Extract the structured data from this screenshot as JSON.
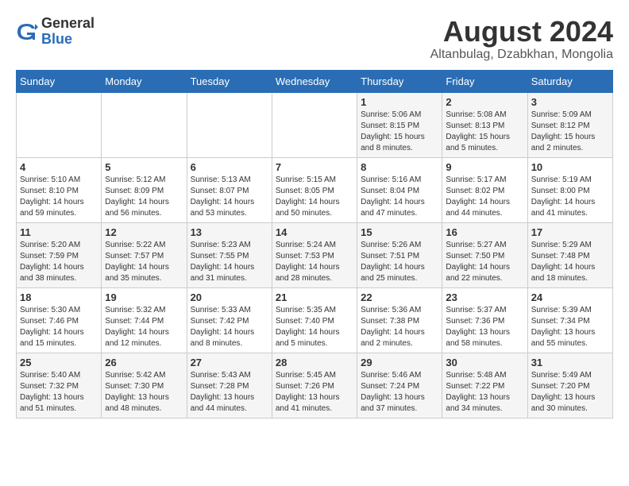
{
  "header": {
    "logo_general": "General",
    "logo_blue": "Blue",
    "month_title": "August 2024",
    "location": "Altanbulag, Dzabkhan, Mongolia"
  },
  "days_of_week": [
    "Sunday",
    "Monday",
    "Tuesday",
    "Wednesday",
    "Thursday",
    "Friday",
    "Saturday"
  ],
  "weeks": [
    [
      {
        "day": "",
        "info": ""
      },
      {
        "day": "",
        "info": ""
      },
      {
        "day": "",
        "info": ""
      },
      {
        "day": "",
        "info": ""
      },
      {
        "day": "1",
        "info": "Sunrise: 5:06 AM\nSunset: 8:15 PM\nDaylight: 15 hours\nand 8 minutes."
      },
      {
        "day": "2",
        "info": "Sunrise: 5:08 AM\nSunset: 8:13 PM\nDaylight: 15 hours\nand 5 minutes."
      },
      {
        "day": "3",
        "info": "Sunrise: 5:09 AM\nSunset: 8:12 PM\nDaylight: 15 hours\nand 2 minutes."
      }
    ],
    [
      {
        "day": "4",
        "info": "Sunrise: 5:10 AM\nSunset: 8:10 PM\nDaylight: 14 hours\nand 59 minutes."
      },
      {
        "day": "5",
        "info": "Sunrise: 5:12 AM\nSunset: 8:09 PM\nDaylight: 14 hours\nand 56 minutes."
      },
      {
        "day": "6",
        "info": "Sunrise: 5:13 AM\nSunset: 8:07 PM\nDaylight: 14 hours\nand 53 minutes."
      },
      {
        "day": "7",
        "info": "Sunrise: 5:15 AM\nSunset: 8:05 PM\nDaylight: 14 hours\nand 50 minutes."
      },
      {
        "day": "8",
        "info": "Sunrise: 5:16 AM\nSunset: 8:04 PM\nDaylight: 14 hours\nand 47 minutes."
      },
      {
        "day": "9",
        "info": "Sunrise: 5:17 AM\nSunset: 8:02 PM\nDaylight: 14 hours\nand 44 minutes."
      },
      {
        "day": "10",
        "info": "Sunrise: 5:19 AM\nSunset: 8:00 PM\nDaylight: 14 hours\nand 41 minutes."
      }
    ],
    [
      {
        "day": "11",
        "info": "Sunrise: 5:20 AM\nSunset: 7:59 PM\nDaylight: 14 hours\nand 38 minutes."
      },
      {
        "day": "12",
        "info": "Sunrise: 5:22 AM\nSunset: 7:57 PM\nDaylight: 14 hours\nand 35 minutes."
      },
      {
        "day": "13",
        "info": "Sunrise: 5:23 AM\nSunset: 7:55 PM\nDaylight: 14 hours\nand 31 minutes."
      },
      {
        "day": "14",
        "info": "Sunrise: 5:24 AM\nSunset: 7:53 PM\nDaylight: 14 hours\nand 28 minutes."
      },
      {
        "day": "15",
        "info": "Sunrise: 5:26 AM\nSunset: 7:51 PM\nDaylight: 14 hours\nand 25 minutes."
      },
      {
        "day": "16",
        "info": "Sunrise: 5:27 AM\nSunset: 7:50 PM\nDaylight: 14 hours\nand 22 minutes."
      },
      {
        "day": "17",
        "info": "Sunrise: 5:29 AM\nSunset: 7:48 PM\nDaylight: 14 hours\nand 18 minutes."
      }
    ],
    [
      {
        "day": "18",
        "info": "Sunrise: 5:30 AM\nSunset: 7:46 PM\nDaylight: 14 hours\nand 15 minutes."
      },
      {
        "day": "19",
        "info": "Sunrise: 5:32 AM\nSunset: 7:44 PM\nDaylight: 14 hours\nand 12 minutes."
      },
      {
        "day": "20",
        "info": "Sunrise: 5:33 AM\nSunset: 7:42 PM\nDaylight: 14 hours\nand 8 minutes."
      },
      {
        "day": "21",
        "info": "Sunrise: 5:35 AM\nSunset: 7:40 PM\nDaylight: 14 hours\nand 5 minutes."
      },
      {
        "day": "22",
        "info": "Sunrise: 5:36 AM\nSunset: 7:38 PM\nDaylight: 14 hours\nand 2 minutes."
      },
      {
        "day": "23",
        "info": "Sunrise: 5:37 AM\nSunset: 7:36 PM\nDaylight: 13 hours\nand 58 minutes."
      },
      {
        "day": "24",
        "info": "Sunrise: 5:39 AM\nSunset: 7:34 PM\nDaylight: 13 hours\nand 55 minutes."
      }
    ],
    [
      {
        "day": "25",
        "info": "Sunrise: 5:40 AM\nSunset: 7:32 PM\nDaylight: 13 hours\nand 51 minutes."
      },
      {
        "day": "26",
        "info": "Sunrise: 5:42 AM\nSunset: 7:30 PM\nDaylight: 13 hours\nand 48 minutes."
      },
      {
        "day": "27",
        "info": "Sunrise: 5:43 AM\nSunset: 7:28 PM\nDaylight: 13 hours\nand 44 minutes."
      },
      {
        "day": "28",
        "info": "Sunrise: 5:45 AM\nSunset: 7:26 PM\nDaylight: 13 hours\nand 41 minutes."
      },
      {
        "day": "29",
        "info": "Sunrise: 5:46 AM\nSunset: 7:24 PM\nDaylight: 13 hours\nand 37 minutes."
      },
      {
        "day": "30",
        "info": "Sunrise: 5:48 AM\nSunset: 7:22 PM\nDaylight: 13 hours\nand 34 minutes."
      },
      {
        "day": "31",
        "info": "Sunrise: 5:49 AM\nSunset: 7:20 PM\nDaylight: 13 hours\nand 30 minutes."
      }
    ]
  ]
}
